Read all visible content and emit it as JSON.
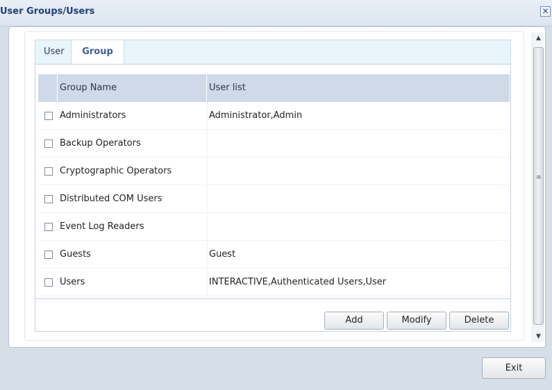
{
  "window": {
    "title": "User Groups/Users",
    "close_label": "✕"
  },
  "tabs": [
    {
      "label": "User",
      "active": false
    },
    {
      "label": "Group",
      "active": true
    }
  ],
  "grid": {
    "columns": [
      "Group Name",
      "User list"
    ],
    "rows": [
      {
        "name": "Administrators",
        "users": "Administrator,Admin",
        "checked": false
      },
      {
        "name": "Backup Operators",
        "users": "",
        "checked": false
      },
      {
        "name": "Cryptographic Operators",
        "users": "",
        "checked": false
      },
      {
        "name": "Distributed COM Users",
        "users": "",
        "checked": false
      },
      {
        "name": "Event Log Readers",
        "users": "",
        "checked": false
      },
      {
        "name": "Guests",
        "users": "Guest",
        "checked": false
      },
      {
        "name": "Users",
        "users": "INTERACTIVE,Authenticated Users,User",
        "checked": false
      }
    ]
  },
  "actions": {
    "add_label": "Add",
    "modify_label": "Modify",
    "delete_label": "Delete"
  },
  "footer": {
    "exit_label": "Exit"
  },
  "scrollbar": {
    "up_icon": "▲",
    "down_icon": "▼",
    "grip_icon": "≡"
  },
  "colors": {
    "title_text": "#1f3f78",
    "frame": "#d6dee8",
    "header_bg": "#cfd9e8",
    "tab_bar_bg": "#e8f6fb",
    "active_tab_text": "#3e5f99"
  }
}
